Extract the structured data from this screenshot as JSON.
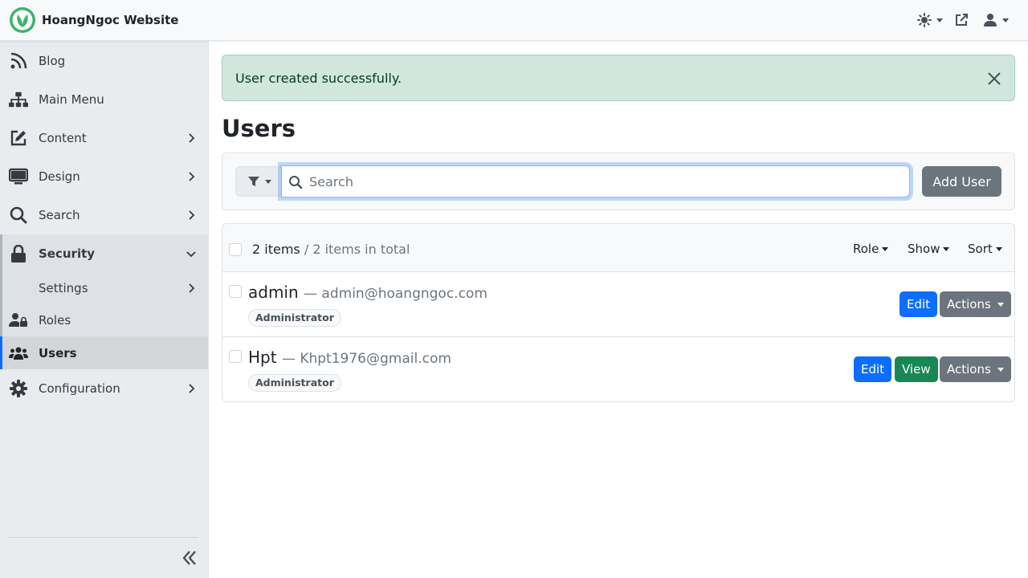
{
  "app": {
    "title": "HoangNgoc Website"
  },
  "header": {
    "theme_icon": "sun-icon",
    "external_icon": "external-link-icon",
    "user_icon": "user-icon"
  },
  "sidebar": {
    "items": [
      {
        "label": "Blog",
        "icon": "rss-icon"
      },
      {
        "label": "Main Menu",
        "icon": "sitemap-icon"
      },
      {
        "label": "Content",
        "icon": "edit-icon"
      },
      {
        "label": "Design",
        "icon": "monitor-icon"
      },
      {
        "label": "Search",
        "icon": "search-icon"
      },
      {
        "label": "Security",
        "icon": "lock-icon"
      },
      {
        "label": "Settings",
        "icon": ""
      },
      {
        "label": "Roles",
        "icon": "user-lock-icon"
      },
      {
        "label": "Users",
        "icon": "users-icon"
      },
      {
        "label": "Configuration",
        "icon": "gear-icon"
      }
    ]
  },
  "alert": {
    "message": "User created successfully."
  },
  "page": {
    "title": "Users"
  },
  "toolbar": {
    "search_placeholder": "Search",
    "add_user_label": "Add User"
  },
  "list": {
    "count_current": "2 items",
    "count_separator": " / ",
    "count_total": "2 items in total",
    "filters": {
      "role": "Role",
      "show": "Show",
      "sort": "Sort"
    },
    "rows": [
      {
        "name": "admin",
        "email": "— admin@hoangngoc.com",
        "role": "Administrator",
        "edit": "Edit",
        "actions": "Actions"
      },
      {
        "name": "Hpt",
        "email": "— Khpt1976@gmail.com",
        "role": "Administrator",
        "edit": "Edit",
        "view": "View",
        "actions": "Actions"
      }
    ]
  },
  "colors": {
    "primary": "#0d6efd",
    "success": "#198754",
    "secondary": "#6c757d",
    "alert_bg": "#d1e7dd",
    "brand_green": "#3cb371"
  }
}
